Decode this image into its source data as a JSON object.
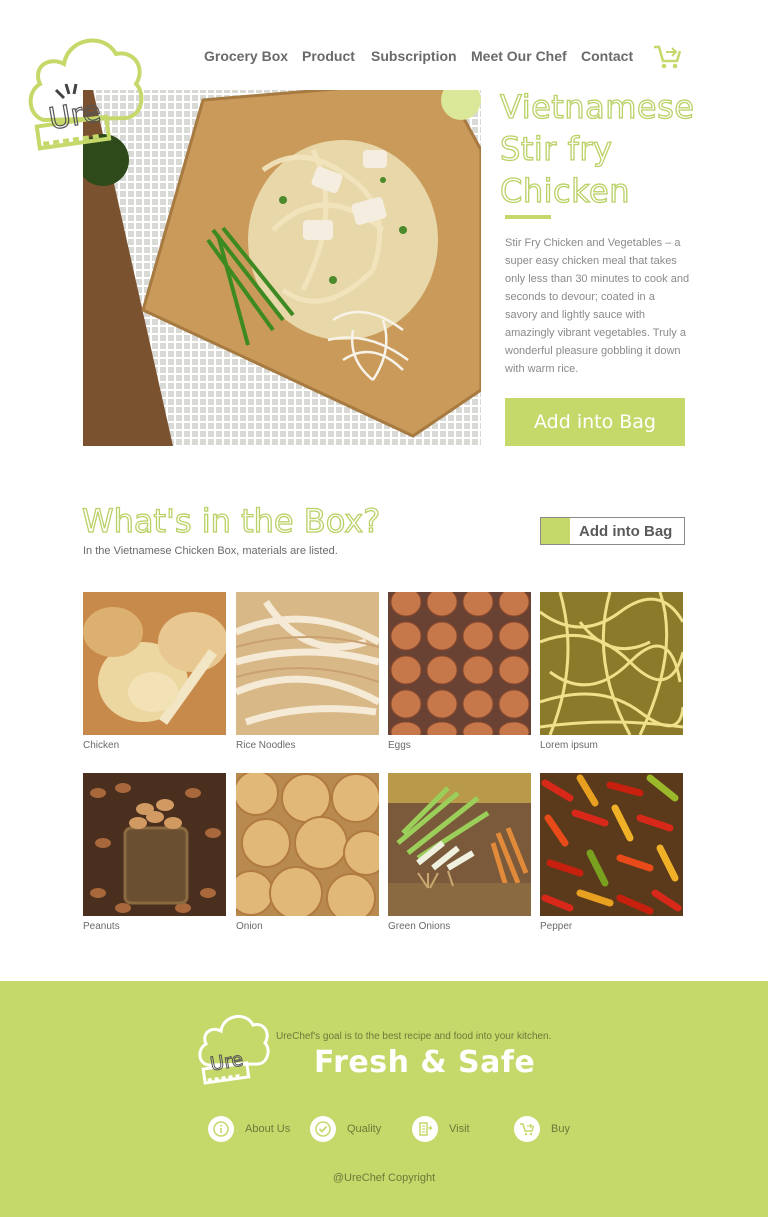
{
  "brand": {
    "logo_text": "Ure",
    "accent": "#c5d96b"
  },
  "nav": {
    "items": [
      "Grocery Box",
      "Product",
      "Subscription",
      "Meet Our Chef",
      "Contact"
    ],
    "cart_icon": "cart-icon"
  },
  "hero": {
    "title": "Vietnamese Stir fry Chicken",
    "description": "Stir Fry Chicken and Vegetables – a super easy chicken meal that takes only less than 30 minutes to cook and seconds to devour; coated in a savory and lightly sauce with amazingly vibrant vegetables. Truly a wonderful pleasure gobbling it down with warm rice.",
    "button": "Add into Bag"
  },
  "box": {
    "title": "What's in the Box?",
    "subtitle": "In the Vietnamese Chicken Box, materials are listed.",
    "button": "Add into Bag",
    "items": [
      "Chicken",
      "Rice Noodles",
      "Eggs",
      "Lorem ipsum",
      "Peanuts",
      "Onion",
      "Green Onions",
      "Pepper"
    ]
  },
  "footer": {
    "goal": "UreChef's goal is to the best recipe and food into your kitchen.",
    "title": "Fresh & Safe",
    "links": [
      {
        "label": "About Us",
        "icon": "info-icon"
      },
      {
        "label": "Quality",
        "icon": "check-icon"
      },
      {
        "label": "Visit",
        "icon": "building-icon"
      },
      {
        "label": "Buy",
        "icon": "cart-icon"
      }
    ],
    "copyright": "@UreChef Copyright"
  }
}
